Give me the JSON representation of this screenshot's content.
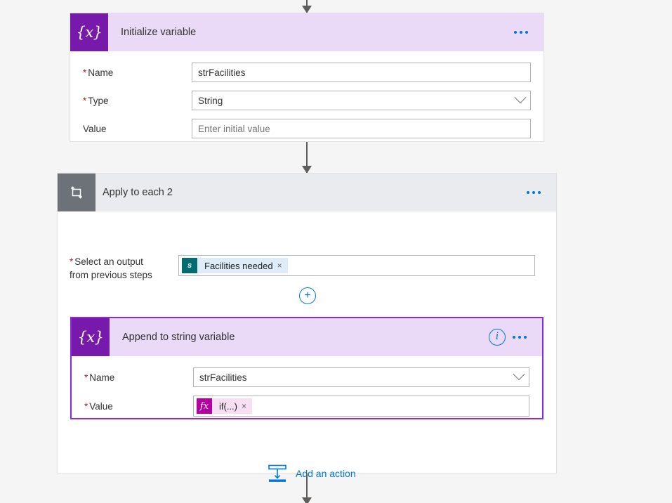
{
  "page": {
    "background": "#f5f5f5",
    "accent_blue": "#0078d4",
    "variable_purple": "#7719aa",
    "selected_purple": "#8a2be2",
    "loop_gray": "#6d7278",
    "required_red": "#a4262c"
  },
  "initialize_variable": {
    "title": "Initialize variable",
    "badge_glyph": "{x}",
    "menu_label": "...",
    "fields": [
      {
        "label": "Name",
        "required": true,
        "value": "strFacilities",
        "is_placeholder": false,
        "dropdown": false
      },
      {
        "label": "Type",
        "required": true,
        "value": "String",
        "is_placeholder": false,
        "dropdown": true
      },
      {
        "label": "Value",
        "required": false,
        "value": "Enter initial value",
        "is_placeholder": true,
        "dropdown": false
      }
    ]
  },
  "apply_to_each": {
    "title": "Apply to each 2",
    "badge_glyph": "loop-icon",
    "menu_label": "...",
    "input_label_line1": "Select an output",
    "input_label_line2": "from previous steps",
    "input_required": true,
    "token": {
      "icon": "sharepoint-icon",
      "icon_glyph": "s",
      "label": "Facilities needed",
      "remove_glyph": "×"
    },
    "add_token_button": "+",
    "add_action": {
      "label": "Add an action",
      "icon": "insert-action-icon"
    }
  },
  "append_to_string": {
    "title": "Append to string variable",
    "badge_glyph": "{x}",
    "info_glyph": "i",
    "menu_label": "...",
    "selected": true,
    "fields": [
      {
        "label": "Name",
        "required": true,
        "value": "strFacilities",
        "is_placeholder": false,
        "dropdown": true
      }
    ],
    "value_field": {
      "label": "Value",
      "required": true,
      "token": {
        "icon": "function-icon",
        "icon_glyph": "fx",
        "label": "if(...)",
        "remove_glyph": "×"
      }
    }
  },
  "connectors": {
    "top": "arrow-down",
    "middle": "arrow-down",
    "bottom": "arrow-down"
  }
}
